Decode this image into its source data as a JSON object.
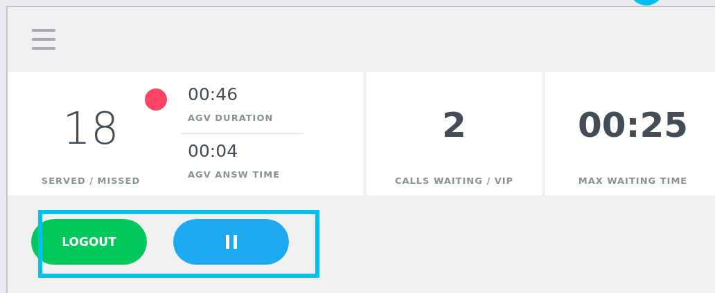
{
  "header": {
    "menu": true
  },
  "served": {
    "value": "18",
    "label": "SERVED / MISSED",
    "indicator": {
      "on": true,
      "color": "#ff4466"
    }
  },
  "averages": [
    {
      "value": "00:46",
      "label": "AGV DURATION"
    },
    {
      "value": "00:04",
      "label": "AGV ANSW TIME"
    }
  ],
  "stats": [
    {
      "value": "2",
      "label": "CALLS WAITING / VIP"
    },
    {
      "value": "00:25",
      "label": "MAX WAITING TIME"
    }
  ],
  "buttons": [
    {
      "kind": "text",
      "label": "LOGOUT",
      "color": "#00c85a"
    },
    {
      "kind": "pause",
      "color": "#1eaaf0"
    }
  ],
  "highlight": {
    "on": true
  }
}
